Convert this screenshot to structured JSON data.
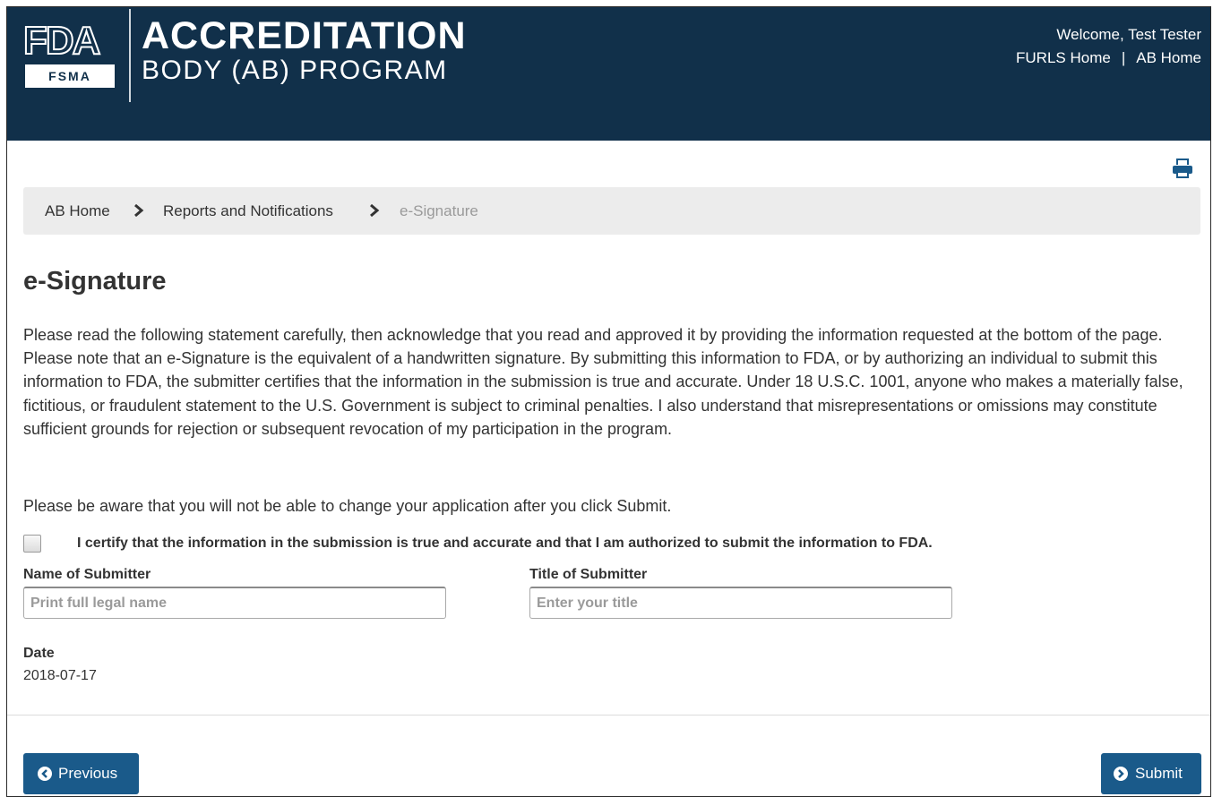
{
  "header": {
    "logo_fda": "FDA",
    "logo_fsma": "FSMA",
    "program_title": "ACCREDITATION",
    "program_subtitle": "BODY (AB) PROGRAM",
    "welcome": "Welcome, Test Tester",
    "links": [
      {
        "label": "FURLS Home"
      },
      {
        "label": "AB Home"
      }
    ],
    "link_separator": "|",
    "background_color": "#11304a"
  },
  "toolbar": {
    "print_icon": "print-icon"
  },
  "breadcrumb": {
    "items": [
      "AB Home",
      "Reports and Notifications"
    ],
    "current": "e-Signature",
    "separator_icon": "chevron-right-icon"
  },
  "page": {
    "title": "e-Signature",
    "statement": "Please read the following statement carefully, then acknowledge that you read and approved it by providing the information requested at the bottom of the page. Please note that an e-Signature is the equivalent of a handwritten signature. By submitting this information to FDA, or by authorizing an individual to submit this information to FDA, the submitter certifies that the information in the submission is true and accurate. Under 18 U.S.C. 1001, anyone who makes a materially false, fictitious, or fraudulent statement to the U.S. Government is subject to criminal penalties. I also understand that misrepresentations or omissions may constitute sufficient grounds for rejection or subsequent revocation of my participation in the program.",
    "aware_note": "Please be aware that you will not be able to change your application after you click Submit."
  },
  "form": {
    "certify": {
      "checked": false,
      "label": "I certify that the information in the submission is true and accurate and that I am authorized to submit the information to FDA."
    },
    "name": {
      "label": "Name of Submitter",
      "value": "",
      "placeholder": "Print full legal name"
    },
    "title": {
      "label": "Title of Submitter",
      "value": "",
      "placeholder": "Enter your title"
    },
    "date": {
      "label": "Date",
      "value": "2018-07-17"
    }
  },
  "actions": {
    "previous": {
      "label": "Previous",
      "icon": "chevron-circle-left-icon"
    },
    "submit": {
      "label": "Submit",
      "icon": "chevron-circle-right-icon"
    },
    "button_color": "#1a5a8a"
  }
}
